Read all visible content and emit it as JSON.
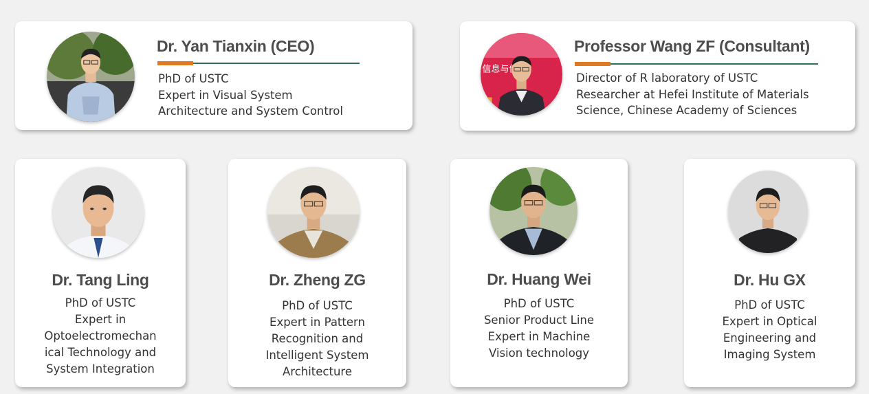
{
  "leaders": [
    {
      "name": "Dr. Yan Tianxin (CEO)",
      "lines": [
        "PhD of USTC",
        "Expert in Visual System",
        "Architecture and System Control"
      ]
    },
    {
      "name": "Professor Wang ZF (Consultant)",
      "lines": [
        "Director of R laboratory of USTC",
        "Researcher at Hefei Institute of Materials",
        "Science, Chinese Academy of Sciences"
      ]
    }
  ],
  "members": [
    {
      "name": "Dr. Tang Ling",
      "lines": [
        "PhD of USTC",
        "Expert in",
        "Optoelectromechan",
        "ical Technology and",
        "System Integration"
      ]
    },
    {
      "name": "Dr. Zheng ZG",
      "lines": [
        "PhD of USTC",
        "Expert in Pattern",
        "Recognition and",
        "Intelligent System",
        "Architecture"
      ]
    },
    {
      "name": "Dr. Huang Wei",
      "lines": [
        "PhD of USTC",
        "Senior Product Line",
        "Expert in Machine",
        "Vision technology"
      ]
    },
    {
      "name": "Dr. Hu GX",
      "lines": [
        "PhD of USTC",
        "Expert in Optical",
        "Engineering and",
        "Imaging System"
      ]
    }
  ],
  "photo_banner_text": "信息与健康"
}
